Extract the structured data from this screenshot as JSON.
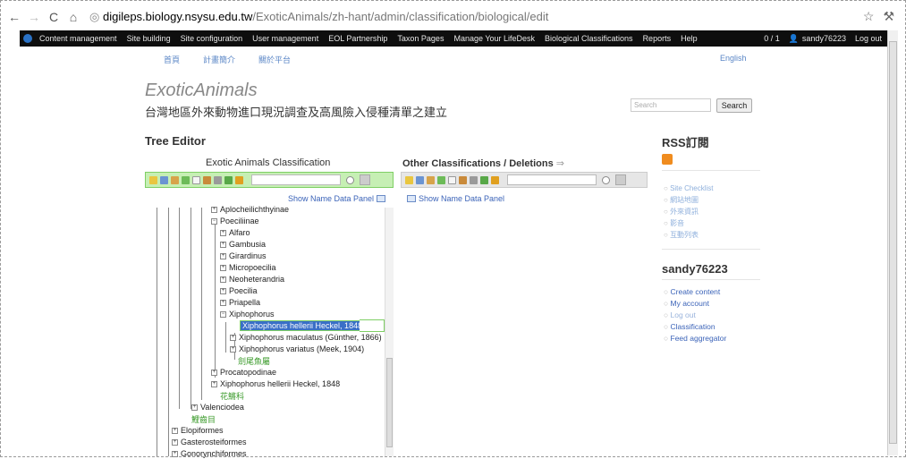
{
  "browser": {
    "url_host": "digileps.biology.nsysu.edu.tw",
    "url_path": "/ExoticAnimals/zh-hant/admin/classification/biological/edit"
  },
  "admin_bar": {
    "items": [
      "Content management",
      "Site building",
      "Site configuration",
      "User management",
      "EOL Partnership",
      "Taxon Pages",
      "Manage Your LifeDesk",
      "Biological Classifications",
      "Reports",
      "Help"
    ],
    "counter": "0 / 1",
    "username": "sandy76223",
    "logout": "Log out"
  },
  "subnav": {
    "items": [
      "首頁",
      "計畫簡介",
      "關於平台"
    ],
    "language": "English"
  },
  "site": {
    "name": "ExoticAnimals",
    "slogan": "台灣地區外來動物進口現況調查及高風險入侵種清單之建立"
  },
  "search": {
    "placeholder": "Search",
    "button": "Search"
  },
  "tree_editor": {
    "title": "Tree Editor",
    "left_pane_title": "Exotic Animals Classification",
    "right_pane_title": "Other Classifications / Deletions",
    "show_name_data_panel": "Show Name Data Panel",
    "nodes": [
      {
        "label": "Aplocheilichthyinae",
        "toggle": "+"
      },
      {
        "label": "Poeciliinae",
        "toggle": "−"
      },
      {
        "label": "Alfaro",
        "toggle": "+"
      },
      {
        "label": "Gambusia",
        "toggle": "+"
      },
      {
        "label": "Girardinus",
        "toggle": "+"
      },
      {
        "label": "Micropoecilia",
        "toggle": "+"
      },
      {
        "label": "Neoheterandria",
        "toggle": "+"
      },
      {
        "label": "Poecilia",
        "toggle": "+"
      },
      {
        "label": "Priapella",
        "toggle": "+"
      },
      {
        "label": "Xiphophorus",
        "toggle": "−"
      },
      {
        "label": "Xiphophorus hellerii Heckel, 1848",
        "toggle": "",
        "selected": true
      },
      {
        "label": "Xiphophorus maculatus (Günther, 1866)",
        "toggle": "+"
      },
      {
        "label": "Xiphophorus variatus (Meek, 1904)",
        "toggle": "+"
      },
      {
        "label": "劍尾魚屬",
        "toggle": "",
        "green": true
      },
      {
        "label": "Procatopodinae",
        "toggle": "+"
      },
      {
        "label": "Xiphophorus hellerii Heckel, 1848",
        "toggle": "+"
      },
      {
        "label": "花鱂科",
        "toggle": "",
        "green": true
      },
      {
        "label": "Valenciodea",
        "toggle": "+"
      },
      {
        "label": "鯉齒目",
        "toggle": "",
        "green": true
      },
      {
        "label": "Elopiformes",
        "toggle": "+"
      },
      {
        "label": "Gasterosteiformes",
        "toggle": "+"
      },
      {
        "label": "Gonorynchiformes",
        "toggle": "+"
      }
    ]
  },
  "sidebar": {
    "rss_title": "RSS訂閱",
    "site_links": [
      "Site Checklist",
      "網站地圖",
      "外來資訊",
      "影音",
      "互動列表"
    ],
    "user_title": "sandy76223",
    "user_links": [
      {
        "label": "Create content"
      },
      {
        "label": "My account"
      },
      {
        "label": "Log out",
        "dim": true
      },
      {
        "label": "Classification"
      },
      {
        "label": "Feed aggregator"
      }
    ]
  },
  "colors": {
    "admin_bar": "#0e0e0e",
    "link": "#3b63b8",
    "tree_selected": "#3a6fc7",
    "toolbar_green": "#c6efb4"
  }
}
